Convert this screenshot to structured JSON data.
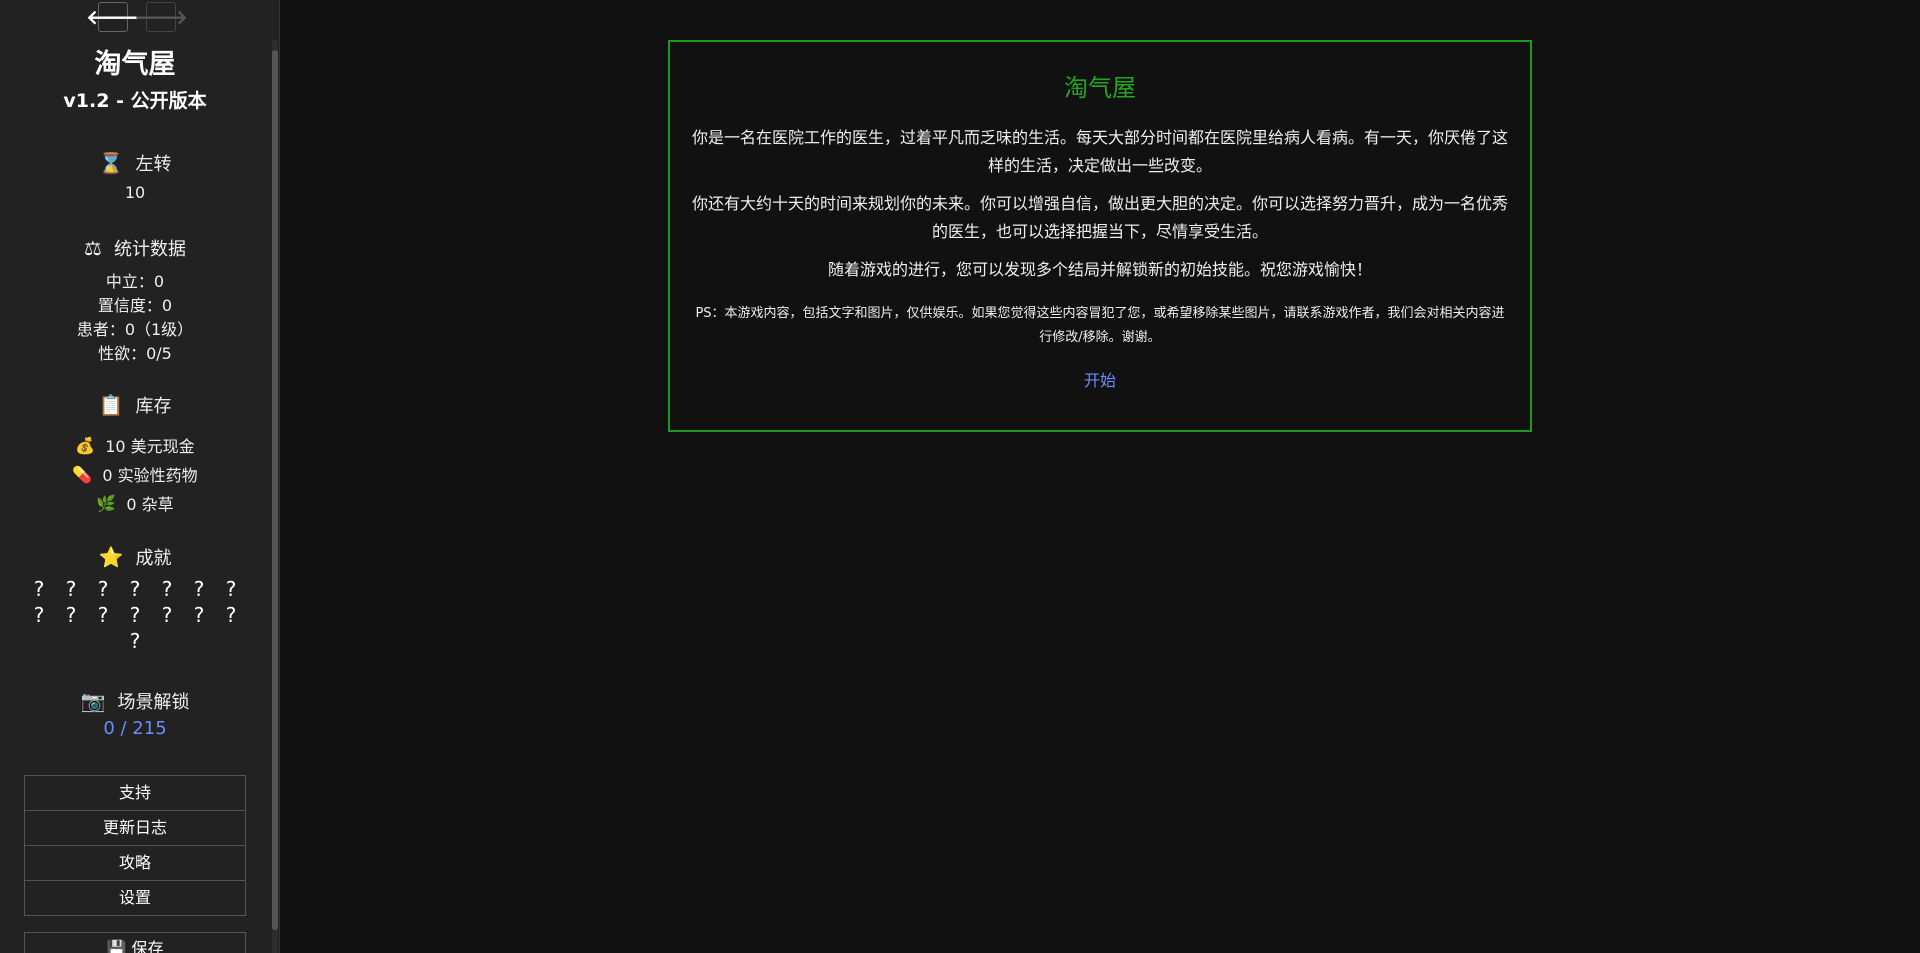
{
  "sidebar": {
    "back_glyph": "🡐",
    "forward_glyph": "🡒",
    "title": "淘气屋",
    "subtitle": "v1.2 - 公开版本",
    "turns": {
      "icon": "⌛",
      "label": "左转",
      "value": "10"
    },
    "stats": {
      "icon": "⚖",
      "label": "统计数据",
      "lines": [
        "中立：0",
        "置信度：0",
        "患者：0（1级）",
        "性欲：0/5"
      ]
    },
    "inventory": {
      "icon": "📋",
      "label": "库存",
      "items": [
        {
          "icon": "💰",
          "text": "10 美元现金"
        },
        {
          "icon": "💊",
          "text": "0 实验性药物"
        },
        {
          "icon": "🌿",
          "text": "0 杂草"
        }
      ]
    },
    "achievements": {
      "icon": "⭐",
      "label": "成就",
      "marks": [
        "?",
        "?",
        "?",
        "?",
        "?",
        "?",
        "?",
        "?",
        "?",
        "?",
        "?",
        "?",
        "?",
        "?",
        "?"
      ]
    },
    "scenes": {
      "icon": "📷",
      "label": "场景解锁",
      "value": "0 / 215"
    },
    "menu": [
      "支持",
      "更新日志",
      "攻略",
      "设置"
    ],
    "save": {
      "icon": "💾",
      "label": "保存"
    }
  },
  "passage": {
    "title": "淘气屋",
    "paragraphs": [
      "你是一名在医院工作的医生，过着平凡而乏味的生活。每天大部分时间都在医院里给病人看病。有一天，你厌倦了这样的生活，决定做出一些改变。",
      "你还有大约十天的时间来规划你的未来。你可以增强自信，做出更大胆的决定。你可以选择努力晋升，成为一名优秀的医生，也可以选择把握当下，尽情享受生活。",
      "随着游戏的进行，您可以发现多个结局并解锁新的初始技能。祝您游戏愉快！"
    ],
    "ps": "PS：本游戏内容，包括文字和图片，仅供娱乐。如果您觉得这些内容冒犯了您，或希望移除某些图片，请联系游戏作者，我们会对相关内容进行修改/移除。谢谢。",
    "start_link": "开始"
  },
  "colors": {
    "background": "#111111",
    "sidebar_bg": "#222222",
    "accent_green": "#1f9a1f",
    "link_blue": "#6b8cff"
  }
}
